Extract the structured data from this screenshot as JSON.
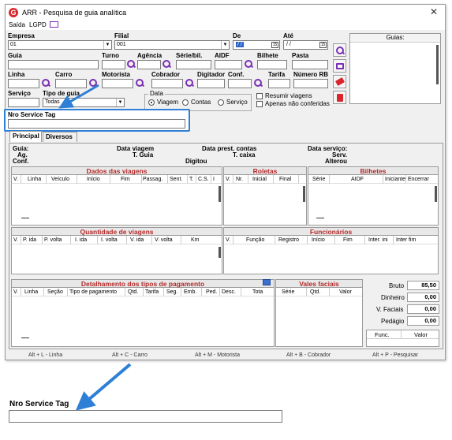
{
  "window": {
    "title": "ARR - Pesquisa de guia analítica",
    "close": "✕"
  },
  "menu": {
    "exit": "Saída",
    "lgpd": "LGPD"
  },
  "fields": {
    "empresa": {
      "label": "Empresa",
      "value": "01"
    },
    "filial": {
      "label": "Filial",
      "value": "001"
    },
    "de": {
      "label": "De",
      "value": "/ /"
    },
    "ate": {
      "label": "Até",
      "value": "/ /"
    },
    "guia": "Guia",
    "turno": "Turno",
    "agencia": "Agência",
    "serie_bil": "Série/bil.",
    "aidf": "AIDF",
    "bilhete": "Bilhete",
    "pasta": "Pasta",
    "linha": "Linha",
    "carro": "Carro",
    "motorista": "Motorista",
    "cobrador": "Cobrador",
    "digitador": "Digitador",
    "conf": "Conf.",
    "tarifa": "Tarifa",
    "numero_rb": "Número RB",
    "servico": "Serviço",
    "tipo_guia": {
      "label": "Tipo de guia",
      "value": "Todas"
    },
    "nro_service_tag": "Nro Service Tag"
  },
  "data_group": {
    "label": "Data",
    "options": [
      "Viagem",
      "Contas",
      "Serviço"
    ]
  },
  "checks": {
    "resumir": "Resumir viagens",
    "apenas": "Apenas não conferidas"
  },
  "guias_list": {
    "header": "Guias:"
  },
  "tabs": [
    "Principal",
    "Diversos"
  ],
  "info": {
    "guia": "Guia:",
    "ag": "Ag.",
    "conf": "Conf.",
    "data_viagem": "Data viagem",
    "t_guia": "T. Guia",
    "data_prest": "Data prest. contas",
    "t_caixa": "T. caixa",
    "digitou": "Digitou",
    "data_servico": "Data serviço:",
    "serv": "Serv.",
    "alterou": "Alterou"
  },
  "sections": {
    "viagens": {
      "title": "Dados das viagens",
      "cols": [
        "V.",
        "Linha",
        "Veículo",
        "Início",
        "Fim",
        "Passag.",
        "Sent.",
        "T.",
        "C.S.",
        "I"
      ]
    },
    "roletas": {
      "title": "Roletas",
      "cols": [
        "V.",
        "Nr.",
        "Inicial",
        "Final"
      ]
    },
    "bilhetes": {
      "title": "Bilhetes",
      "cols": [
        "Série",
        "AIDF",
        "Iniciante",
        "Encerrar"
      ]
    },
    "qtd_viagens": {
      "title": "Quantidade de viagens",
      "cols": [
        "V.",
        "P. ida",
        "P. volta",
        "I. ida",
        "I. volta",
        "V. ida",
        "V. volta",
        "Km"
      ]
    },
    "funcionarios": {
      "title": "Funcionários",
      "cols": [
        "V.",
        "Função",
        "Registro",
        "Início",
        "Fim",
        "Inter. ini",
        "Inter fim"
      ]
    },
    "pagamento": {
      "title": "Detalhamento dos tipos de pagamento",
      "cols": [
        "V.",
        "Linha",
        "Seção",
        "Tipo de pagamento",
        "Qtd.",
        "Tarifa",
        "Seg.",
        "Emb.",
        "Ped.",
        "Desc.",
        "Tota"
      ]
    },
    "vales": {
      "title": "Vales faciais",
      "cols": [
        "Série",
        "Qtd.",
        "Valor"
      ]
    }
  },
  "totals": {
    "bruto": {
      "label": "Bruto",
      "value": "85,50"
    },
    "dinheiro": {
      "label": "Dinheiro",
      "value": "0,00"
    },
    "v_faciais": {
      "label": "V. Faciais",
      "value": "0,00"
    },
    "pedagio": {
      "label": "Pedágio",
      "value": "0,00"
    },
    "func": "Func.",
    "valor": "Valor"
  },
  "shortcuts": [
    "Alt + L - Linha",
    "Alt + C - Carro",
    "Alt + M - Motorista",
    "Alt + B - Cobrador",
    "Alt + P - Pesquisar"
  ],
  "zoom_callout": {
    "label": "Nro Service Tag"
  },
  "colors": {
    "accent": "#2e7fd6",
    "section_title": "#b52a2a",
    "search_icon": "#7b2fb5"
  }
}
